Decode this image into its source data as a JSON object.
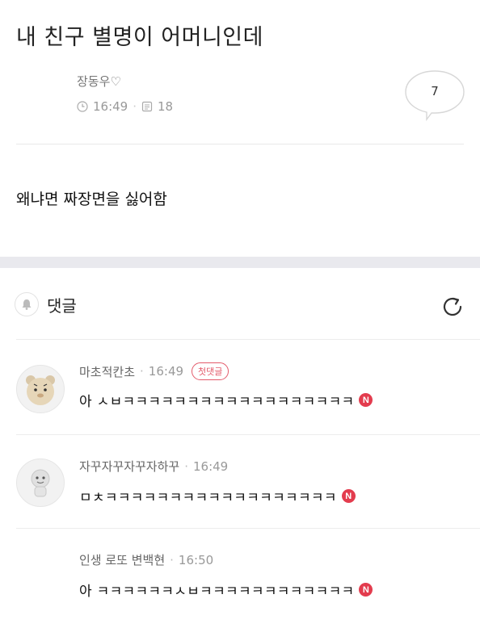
{
  "post": {
    "title": "내 친구 별명이 어머니인데",
    "author": "장동우♡",
    "time": "16:49",
    "views": "18",
    "comment_count": "7",
    "body": "왜냐면 짜장면을 싫어함"
  },
  "comments_section": {
    "label": "댓글"
  },
  "comments": [
    {
      "author": "마초적칸초",
      "time": "16:49",
      "badge": "첫댓글",
      "text": "아 ㅅㅂㅋㅋㅋㅋㅋㅋㅋㅋㅋㅋㅋㅋㅋㅋㅋㅋㅋㅋ",
      "new_mark": "N"
    },
    {
      "author": "자꾸자꾸자꾸자하꾸",
      "time": "16:49",
      "text": "ㅁㅊㅋㅋㅋㅋㅋㅋㅋㅋㅋㅋㅋㅋㅋㅋㅋㅋㅋㅋ",
      "new_mark": "N"
    },
    {
      "author": "인생 로또 변백현",
      "time": "16:50",
      "text": "아 ㅋㅋㅋㅋㅋㅋㅅㅂㅋㅋㅋㅋㅋㅋㅋㅋㅋㅋㅋㅋ",
      "new_mark": "N"
    }
  ],
  "colors": {
    "accent_red": "#e33c4e",
    "divider": "#ececec",
    "section_gap": "#e9e9ee"
  }
}
